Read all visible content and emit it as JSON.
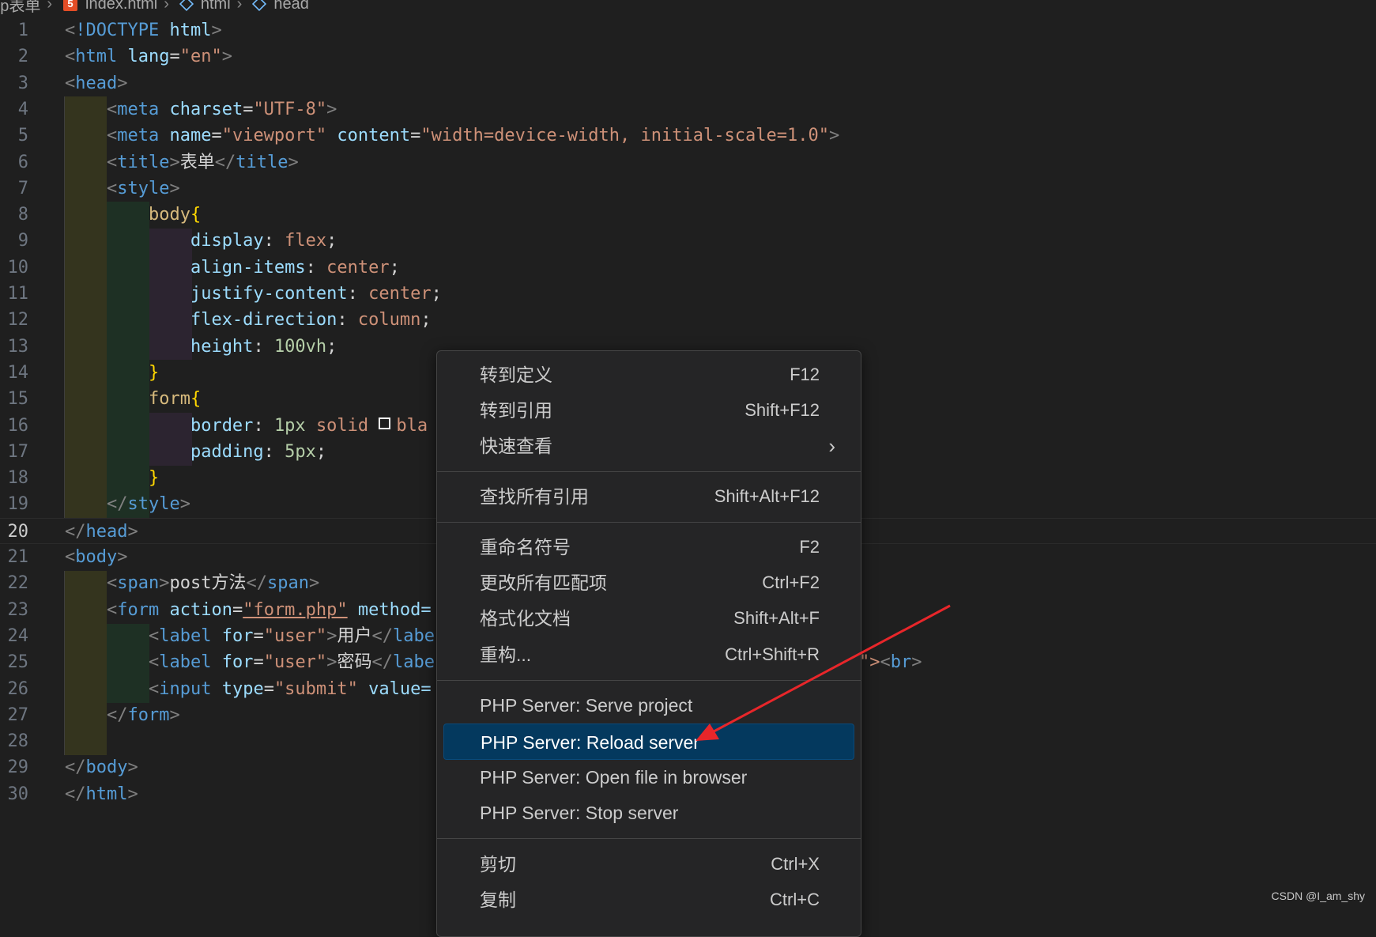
{
  "breadcrumb": {
    "folder": "php表单",
    "file": "index.html",
    "node1": "html",
    "node2": "head"
  },
  "gutter": {
    "current_line": 20
  },
  "code_lines": [
    {
      "n": "1"
    },
    {
      "n": "2"
    },
    {
      "n": "3"
    },
    {
      "n": "4"
    },
    {
      "n": "5"
    },
    {
      "n": "6"
    },
    {
      "n": "7"
    },
    {
      "n": "8"
    },
    {
      "n": "9"
    },
    {
      "n": "10"
    },
    {
      "n": "11"
    },
    {
      "n": "12"
    },
    {
      "n": "13"
    },
    {
      "n": "14"
    },
    {
      "n": "15"
    },
    {
      "n": "16"
    },
    {
      "n": "17"
    },
    {
      "n": "18"
    },
    {
      "n": "19"
    },
    {
      "n": "20"
    },
    {
      "n": "21"
    },
    {
      "n": "22"
    },
    {
      "n": "23"
    },
    {
      "n": "24"
    },
    {
      "n": "25"
    },
    {
      "n": "26"
    },
    {
      "n": "27"
    },
    {
      "n": "28"
    },
    {
      "n": "29"
    },
    {
      "n": "30"
    }
  ],
  "code": {
    "l1_doctype": "!DOCTYPE",
    "l1_html": "html",
    "l2_tag": "html",
    "l2_attr": "lang",
    "l2_val": "\"en\"",
    "l3_tag": "head",
    "l4_tag": "meta",
    "l4_attr": "charset",
    "l4_val": "\"UTF-8\"",
    "l5_tag": "meta",
    "l5_attr1": "name",
    "l5_val1": "\"viewport\"",
    "l5_attr2": "content",
    "l5_val2": "\"width=device-width, initial-scale=1.0\"",
    "l6_tag": "title",
    "l6_text": "表单",
    "l7_tag": "style",
    "l8_sel": "body",
    "l9_prop": "display",
    "l9_val": "flex",
    "l10_prop": "align-items",
    "l10_val": "center",
    "l11_prop": "justify-content",
    "l11_val": "center",
    "l12_prop": "flex-direction",
    "l12_val": "column",
    "l13_prop": "height",
    "l13_val": "100vh",
    "l15_sel": "form",
    "l16_prop": "border",
    "l16_num": "1px",
    "l16_val": "solid",
    "l16_val2": "bla",
    "l17_prop": "padding",
    "l17_val": "5px",
    "l19_tag": "style",
    "l20_tag": "head",
    "l21_tag": "body",
    "l22_tag": "span",
    "l22_text": "post方法",
    "l23_tag": "form",
    "l23_attr1": "action",
    "l23_val1": "\"form.php\"",
    "l23_attr2": "method=",
    "l24_tag": "label",
    "l24_attr": "for",
    "l24_val": "\"user\"",
    "l24_text": "用户",
    "l24_end": "labe",
    "l25_tag": "label",
    "l25_attr": "for",
    "l25_val": "\"user\"",
    "l25_text": "密码",
    "l25_end": "labe",
    "l25_tail": "\">",
    "l25_br": "br",
    "l26_tag": "input",
    "l26_attr1": "type",
    "l26_val1": "\"submit\"",
    "l26_attr2": "value=",
    "l27_tag": "form",
    "l29_tag": "body",
    "l30_tag": "html"
  },
  "context_menu": {
    "go_to_definition": {
      "label": "转到定义",
      "key": "F12"
    },
    "go_to_references": {
      "label": "转到引用",
      "key": "Shift+F12"
    },
    "peek": {
      "label": "快速查看"
    },
    "find_all_references": {
      "label": "查找所有引用",
      "key": "Shift+Alt+F12"
    },
    "rename_symbol": {
      "label": "重命名符号",
      "key": "F2"
    },
    "change_all_occurrences": {
      "label": "更改所有匹配项",
      "key": "Ctrl+F2"
    },
    "format_document": {
      "label": "格式化文档",
      "key": "Shift+Alt+F"
    },
    "refactor": {
      "label": "重构...",
      "key": "Ctrl+Shift+R"
    },
    "php_serve_project": {
      "label": "PHP Server: Serve project"
    },
    "php_reload_server": {
      "label": "PHP Server: Reload server"
    },
    "php_open_in_browser": {
      "label": "PHP Server: Open file in browser"
    },
    "php_stop_server": {
      "label": "PHP Server: Stop server"
    },
    "cut": {
      "label": "剪切",
      "key": "Ctrl+X"
    },
    "copy": {
      "label": "复制",
      "key": "Ctrl+C"
    }
  },
  "colors": {
    "highlight": "#04395e",
    "arrow": "#e8262a",
    "accent_blue": "#569cd6"
  },
  "watermark": "CSDN @I_am_shy"
}
